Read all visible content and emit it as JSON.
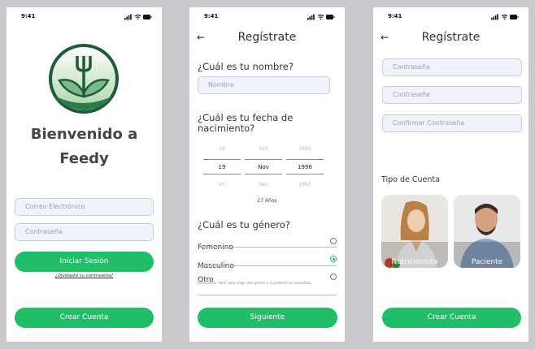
{
  "status": {
    "time": "9:41"
  },
  "login": {
    "welcome_line1": "Bienvenido a",
    "welcome_line2": "Feedy",
    "email_placeholder": "Correo Electrónico",
    "password_placeholder": "Contraseña",
    "login_button": "Iniciar Sesión",
    "forgot_link": "¿Olvidaste tu contraseña?",
    "create_button": "Crear Cuenta"
  },
  "register1": {
    "title": "Regístrate",
    "name_question": "¿Cuál es tu nombre?",
    "name_placeholder": "Nombre",
    "dob_question_line1": "¿Cuál es tu fecha de",
    "dob_question_line2": "nacimiento?",
    "picker": {
      "day": {
        "prev": "18",
        "selected": "19",
        "next": "20"
      },
      "month": {
        "prev": "Oct",
        "selected": "Nov",
        "next": "Dec"
      },
      "year": {
        "prev": "1995",
        "selected": "1996",
        "next": "1997"
      }
    },
    "age_text": "27 Años",
    "gender_question": "¿Cuál es tu género?",
    "gender_options": [
      {
        "label": "Femenino",
        "selected": false
      },
      {
        "label": "Masculino",
        "selected": true
      },
      {
        "label": "Otro",
        "selected": false
      }
    ],
    "other_hint": "Seleccionar \"otro\" para elegir otro género o si prefieres no especificar.",
    "next_button": "Siguiente"
  },
  "register2": {
    "title": "Regístrate",
    "password_placeholder": "Contraseña",
    "password2_placeholder": "Contraseña",
    "confirm_placeholder": "Confirmar Contraseña",
    "account_type_label": "Tipo de Cuenta",
    "cards": [
      {
        "label": "Nutricionista"
      },
      {
        "label": "Paciente"
      }
    ],
    "create_button": "Crear Cuenta"
  },
  "colors": {
    "accent": "#22bd68",
    "field_bg": "#f1f3fb",
    "logo_dark": "#1f5a3a"
  }
}
